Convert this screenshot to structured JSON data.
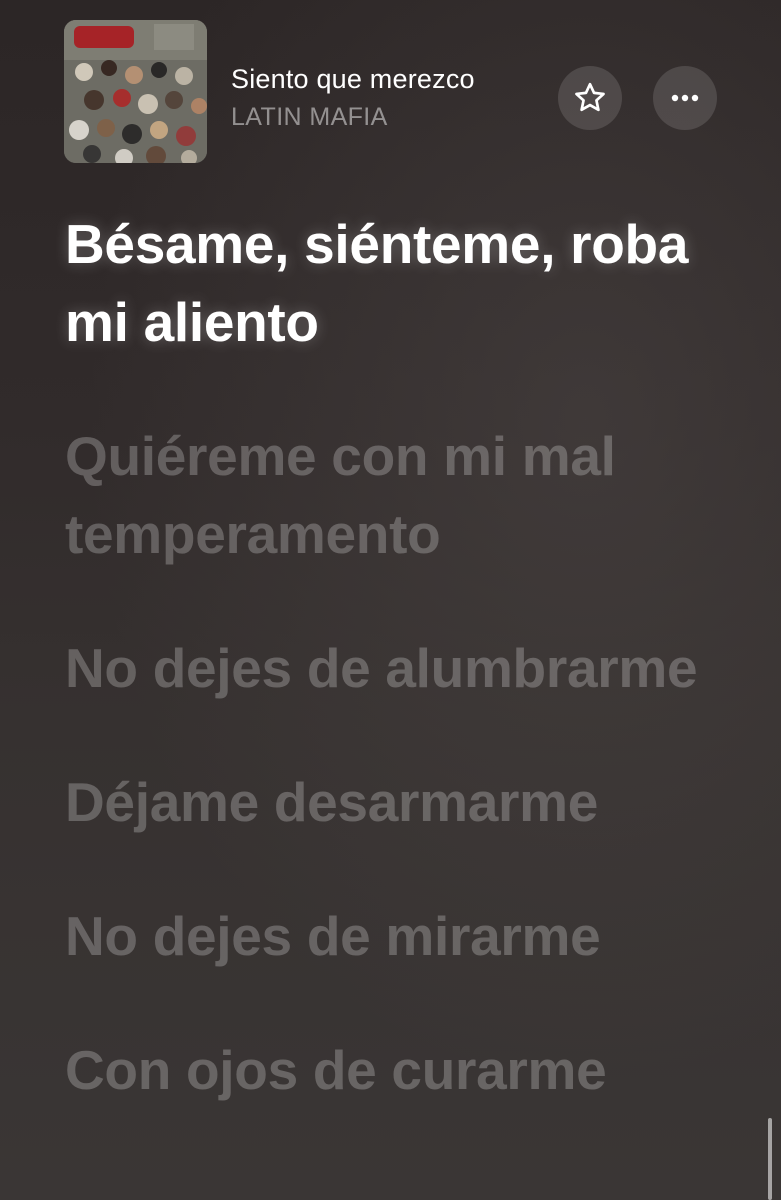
{
  "now_playing": {
    "title": "Siento que merezco",
    "artist": "LATIN MAFIA",
    "artwork_icon": "album-artwork-crowd-photo"
  },
  "buttons": {
    "favorite_icon": "star-icon",
    "more_icon": "ellipsis-icon"
  },
  "lyrics": [
    {
      "text": "Bésame, siénteme, roba mi aliento",
      "active": true
    },
    {
      "text": "Quiéreme con mi mal temperamento",
      "active": false
    },
    {
      "text": "No dejes de alumbrarme",
      "active": false
    },
    {
      "text": "Déjame desarmarme",
      "active": false
    },
    {
      "text": "No dejes de mirarme",
      "active": false
    },
    {
      "text": "Con ojos de curarme",
      "active": false
    }
  ],
  "colors": {
    "background": "#2f2929",
    "active_lyric": "#ffffff",
    "inactive_lyric": "rgba(255,255,255,0.24)",
    "artist_text": "rgba(255,255,255,0.48)"
  }
}
